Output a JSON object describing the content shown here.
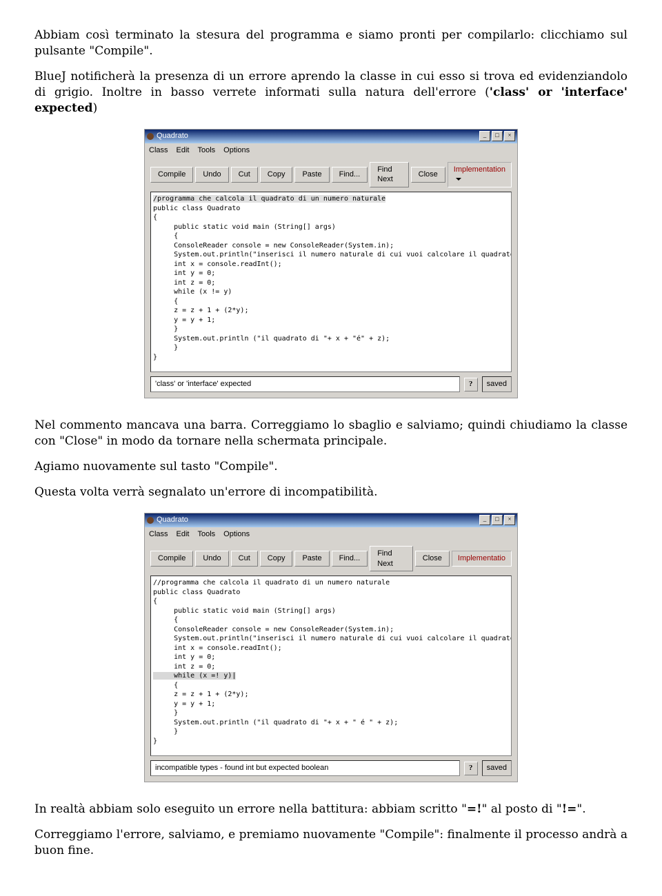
{
  "para1": "Abbiam così terminato la stesura del programma e siamo pronti per compilarlo: clicchiamo sul pulsante \"Compile\".",
  "para2a": "BlueJ notificherà la presenza di un errore aprendo la  classe in cui esso si trova ed evidenziandolo di grigio. Inoltre in basso verrete informati sulla natura dell'errore (",
  "para2b": "'class' or 'interface' expected",
  "para2c": ")",
  "para3": "Nel commento mancava una barra. Correggiamo lo sbaglio e salviamo; quindi chiudiamo la classe con \"Close\" in modo da tornare nella schermata principale.",
  "para4": "Agiamo nuovamente sul tasto \"Compile\".",
  "para5": "Questa volta verrà segnalato un'errore di incompatibilità.",
  "para6a": "In realtà abbiam solo eseguito un errore nella battitura: abbiam scritto \"",
  "para6b": "=!",
  "para6c": "\" al posto di \"",
  "para6d": "!=",
  "para6e": "\".",
  "para7": "Correggiamo l'errore, salviamo, e premiamo nuovamente \"Compile\": finalmente il processo andrà a buon fine.",
  "win": {
    "title": "Quadrato",
    "menu": {
      "class": "Class",
      "edit": "Edit",
      "tools": "Tools",
      "options": "Options"
    },
    "btn": {
      "compile": "Compile",
      "undo": "Undo",
      "cut": "Cut",
      "copy": "Copy",
      "paste": "Paste",
      "find": "Find...",
      "findnext": "Find Next",
      "close": "Close"
    },
    "impl": "Implementation",
    "impl2": "Implementatio",
    "status1": "'class' or 'interface' expected",
    "status2": "incompatible types - found int but expected boolean",
    "saved": "saved"
  },
  "code1": {
    "l1": "/programma che calcola il quadrato di un numero naturale",
    "l2": "public class Quadrato",
    "l3": "{",
    "l4": "     public static void main (String[] args)",
    "l5": "     {",
    "l6": "     ConsoleReader console = new ConsoleReader(System.in);",
    "l7": "     System.out.println(\"inserisci il numero naturale di cui vuoi calcolare il quadrato\");",
    "l8": "     int x = console.readInt();",
    "l9": "     int y = 0;",
    "l10": "     int z = 0;",
    "l11": "     while (x != y)",
    "l12": "     {",
    "l13": "     z = z + 1 + (2*y);",
    "l14": "     y = y + 1;",
    "l15": "     }",
    "l16": "     System.out.println (\"il quadrato di \"+ x + \"é\" + z);",
    "l17": "     }",
    "l18": "}"
  },
  "code2": {
    "l1": "//programma che calcola il quadrato di un numero naturale",
    "l2": "public class Quadrato",
    "l3": "{",
    "l4": "     public static void main (String[] args)",
    "l5": "     {",
    "l6": "     ConsoleReader console = new ConsoleReader(System.in);",
    "l7": "     System.out.println(\"inserisci il numero naturale di cui vuoi calcolare il quadrato\");",
    "l8": "     int x = console.readInt();",
    "l9": "     int y = 0;",
    "l10": "     int z = 0;",
    "l11": "     while (x =! y)|",
    "l12": "     {",
    "l13": "     z = z + 1 + (2*y);",
    "l14": "     y = y + 1;",
    "l15": "     }",
    "l16": "     System.out.println (\"il quadrato di \"+ x + \" é \" + z);",
    "l17": "     }",
    "l18": "}"
  }
}
